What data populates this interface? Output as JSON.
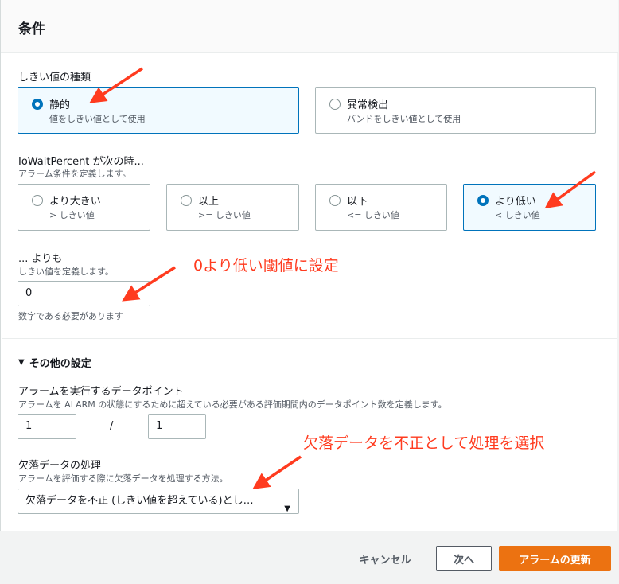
{
  "panel": {
    "title": "条件"
  },
  "threshold_type": {
    "label": "しきい値の種類",
    "options": [
      {
        "title": "静的",
        "sub": "値をしきい値として使用",
        "selected": true
      },
      {
        "title": "異常検出",
        "sub": "バンドをしきい値として使用",
        "selected": false
      }
    ]
  },
  "condition": {
    "label": "IoWaitPercent が次の時...",
    "desc": "アラーム条件を定義します。",
    "options": [
      {
        "title": "より大きい",
        "sub": "> しきい値",
        "selected": false
      },
      {
        "title": "以上",
        "sub": ">= しきい値",
        "selected": false
      },
      {
        "title": "以下",
        "sub": "<= しきい値",
        "selected": false
      },
      {
        "title": "より低い",
        "sub": "< しきい値",
        "selected": true
      }
    ]
  },
  "than": {
    "label": "... よりも",
    "desc": "しきい値を定義します。",
    "value": "0",
    "hint": "数字である必要があります"
  },
  "additional": {
    "toggle_icon": "triangle-down-icon",
    "label": "その他の設定",
    "datapoints_label": "アラームを実行するデータポイント",
    "datapoints_desc": "アラームを ALARM の状態にするために超えている必要がある評価期間内のデータポイント数を定義します。",
    "datapoints_value": "1",
    "separator": "/",
    "period_value": "1",
    "missing_label": "欠落データの処理",
    "missing_desc": "アラームを評価する際に欠落データを処理する方法。",
    "missing_selected": "欠落データを不正 (しきい値を超えている)とし…"
  },
  "annotations": {
    "threshold_note": "0より低い閾値に設定",
    "missing_note": "欠落データを不正として処理を選択",
    "color": "#ff3b1f"
  },
  "footer": {
    "cancel": "キャンセル",
    "next": "次へ",
    "update": "アラームの更新"
  },
  "colors": {
    "primary": "#ec7211",
    "selected_border": "#0073bb",
    "selected_bg": "#f1faff"
  }
}
